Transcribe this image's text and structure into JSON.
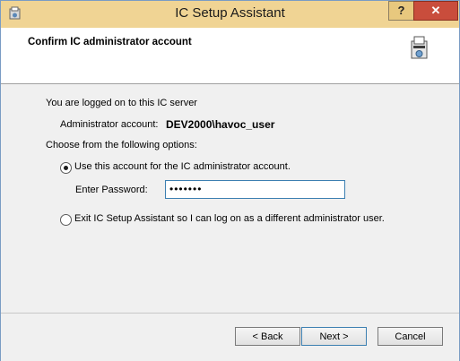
{
  "window": {
    "title": "IC Setup Assistant"
  },
  "titlebar": {
    "help_label": "?",
    "close_label": "✕"
  },
  "header": {
    "title": "Confirm IC administrator account"
  },
  "main": {
    "logged_on_text": "You are logged on to this IC server",
    "admin_label": "Administrator account:",
    "admin_value": "DEV2000\\havoc_user",
    "choose_text": "Choose from the following options:",
    "option_use": "Use this account for the IC administrator account.",
    "password_label": "Enter Password:",
    "password_value": "•••••••",
    "option_exit": "Exit IC Setup Assistant so I can log on as a different administrator user."
  },
  "footer": {
    "back_label": "< Back",
    "next_label": "Next >",
    "cancel_label": "Cancel"
  },
  "colors": {
    "titlebar": "#f0d494",
    "close": "#c94d3c",
    "accent": "#3c7fb1"
  }
}
